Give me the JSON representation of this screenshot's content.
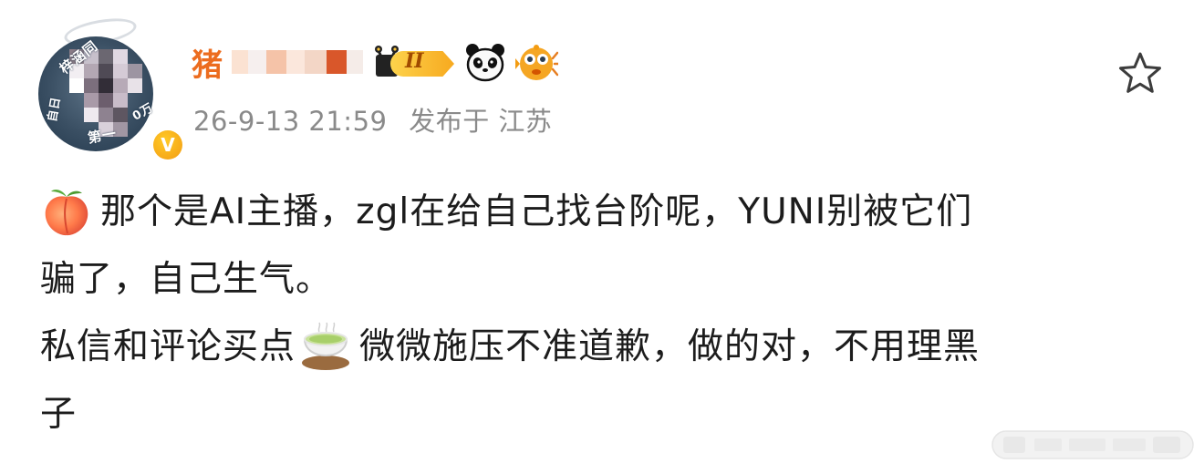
{
  "post": {
    "author": {
      "name": "猪",
      "level": "II",
      "avatar_ring_text": {
        "top": "梓涵同",
        "left": "自日",
        "bottom": "第一",
        "right": "0万"
      },
      "verified_mark": "V"
    },
    "timestamp": "26-9-13 21:59",
    "location": "发布于 江苏",
    "lines": [
      {
        "emoji": "peach-emoji",
        "text": "那个是AI主播，zgl在给自己找台阶呢，YUNI别被它们"
      },
      {
        "text": "骗了，自己生气。"
      },
      {
        "before": "私信和评论买点",
        "emoji": "tea-emoji",
        "after": "微微施压不准道歉，做的对，不用理黑"
      },
      {
        "text": "子"
      }
    ]
  },
  "colors": {
    "username": "#ec6c1f",
    "meta": "#8a8a8a",
    "text": "#1c1c1c"
  }
}
